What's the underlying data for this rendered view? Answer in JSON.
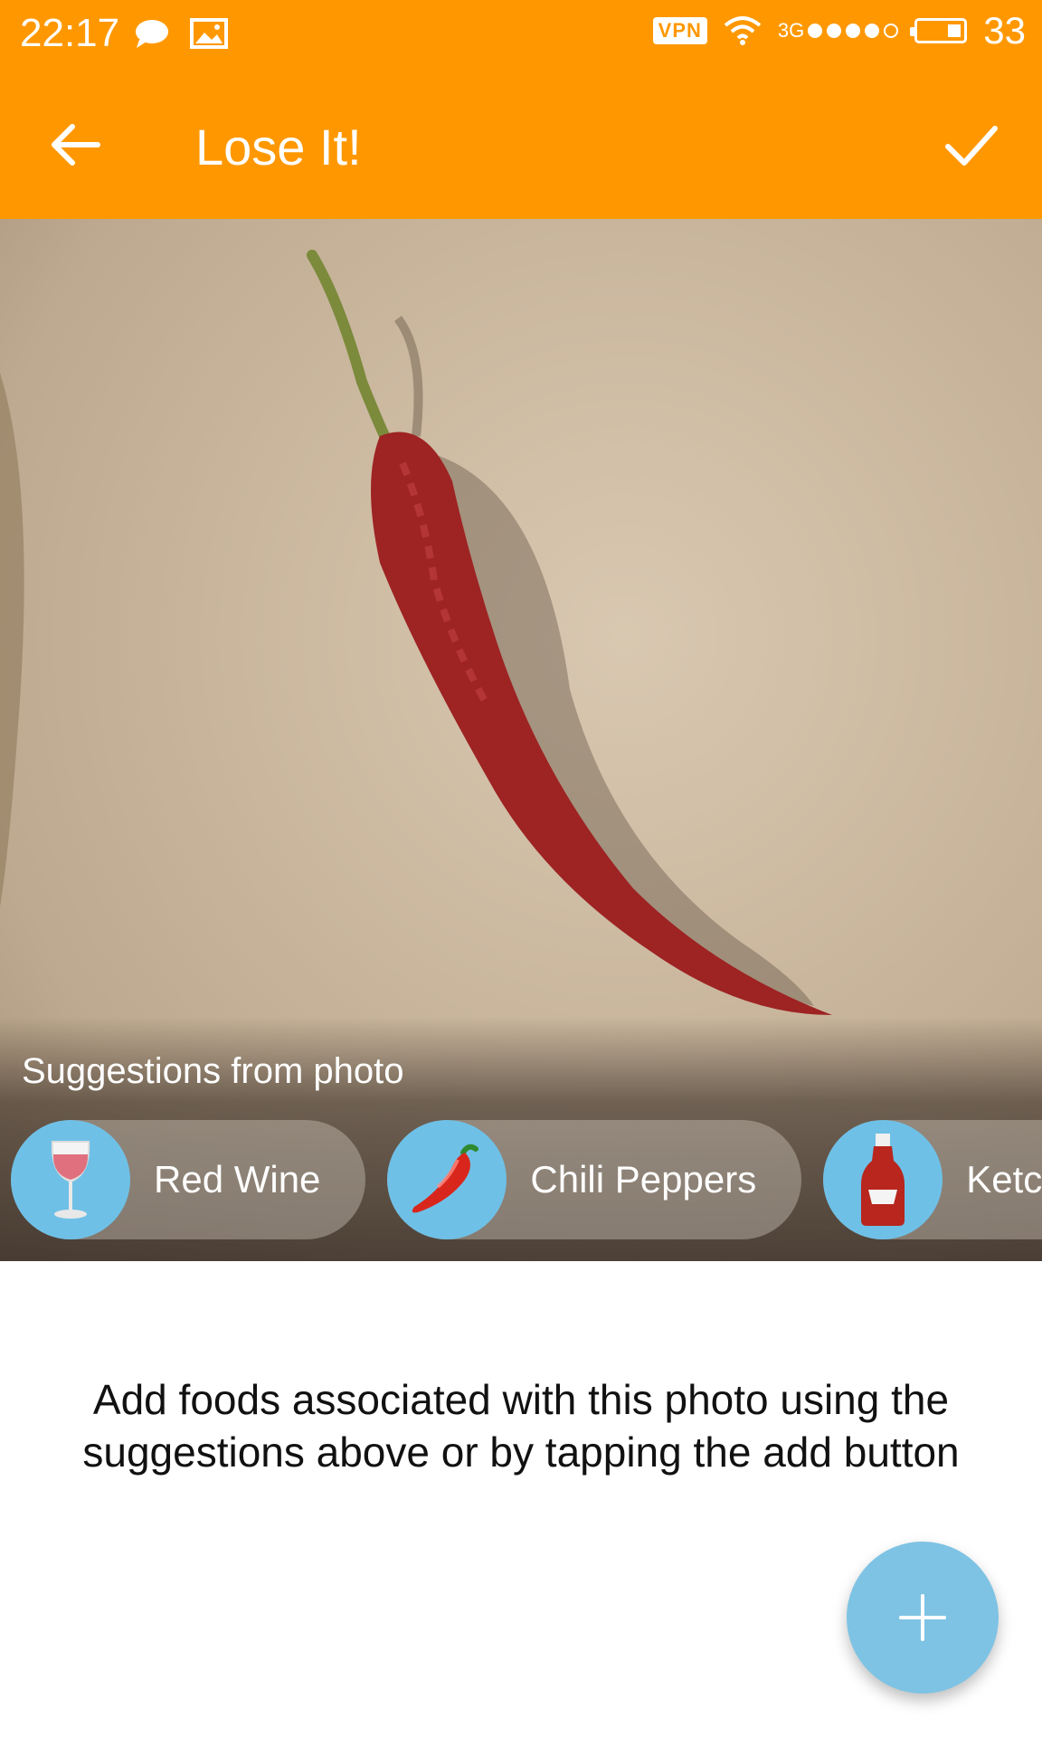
{
  "status_bar": {
    "time": "22:17",
    "left_icons": [
      "chat-bubble-icon",
      "image-icon"
    ],
    "vpn": "VPN",
    "network": "3G",
    "signal_dots": 5,
    "battery": "33"
  },
  "app_bar": {
    "title": "Lose It!",
    "back_icon": "arrow-left-icon",
    "confirm_icon": "checkmark-icon",
    "color": "#FF9800"
  },
  "photo": {
    "subject": "chili-pepper-photo"
  },
  "suggestions": {
    "title": "Suggestions from photo",
    "items": [
      {
        "label": "Red Wine",
        "icon": "wine-glass-icon"
      },
      {
        "label": "Chili Peppers",
        "icon": "chili-pepper-icon"
      },
      {
        "label": "Ketch",
        "icon": "ketchup-bottle-icon"
      }
    ]
  },
  "hint": {
    "line1": "Add foods associated with this photo using the",
    "line2": "suggestions above or by tapping the add button"
  },
  "fab": {
    "icon": "plus-icon",
    "color": "#7ec3e4"
  }
}
